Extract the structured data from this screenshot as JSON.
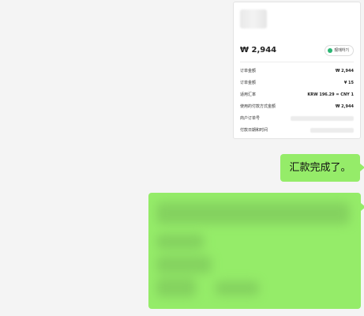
{
  "card": {
    "amount": "₩ 2,944",
    "badge_label": "现메하기",
    "rows": [
      {
        "label": "订单金额",
        "value": "₩ 2,944"
      },
      {
        "label": "订单金额",
        "value": "¥ 15"
      },
      {
        "label": "适用汇率",
        "value": "KRW 196.29 = CNY 1"
      },
      {
        "label": "使用的付款方式金额",
        "value": "₩ 2,944"
      },
      {
        "label": "商户订单号",
        "value": ""
      },
      {
        "label": "付款日期和时间",
        "value": ""
      }
    ]
  },
  "messages": {
    "remittance_done": "汇款完成了。"
  },
  "colors": {
    "bubble": "#95ec69",
    "background": "#f4f4f4",
    "card": "#ffffff"
  }
}
